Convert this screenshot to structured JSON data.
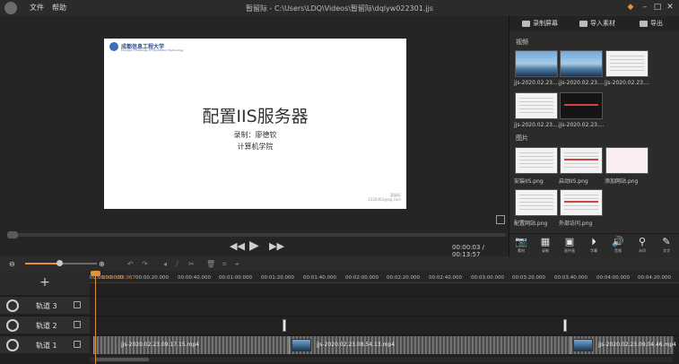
{
  "titlebar": {
    "menu": [
      "文件",
      "帮助"
    ],
    "title": "暂留际 - C:\\Users\\LDQ\\Videos\\暂留际\\dqlyw022301.jjs"
  },
  "preview": {
    "slide": {
      "university": "成都信息工程大学",
      "university_en": "Chengdu University of Information Technology",
      "title": "配置IIS服务器",
      "line1": "录制：廖德钦",
      "line2": "计算机学院",
      "watermark_line1": "暂留际",
      "watermark_line2": "2220062@qq.com"
    },
    "timecode": "00:00:03 / 00:13:57"
  },
  "rightpanel": {
    "tabs": [
      "录制屏幕",
      "导入素材",
      "导出"
    ],
    "videos_label": "视频",
    "videos": [
      {
        "label": "jjs-2020.02.23....",
        "style": "sky"
      },
      {
        "label": "jjs-2020.02.23....",
        "style": "sky"
      },
      {
        "label": "jjs-2020.02.23....",
        "style": "doc"
      },
      {
        "label": "jjs-2020.02.23....",
        "style": "doc"
      },
      {
        "label": "jjs-2020.02.23....",
        "style": "dark"
      }
    ],
    "images_label": "图片",
    "images": [
      {
        "label": "安装IIS.png",
        "style": "doc"
      },
      {
        "label": "启动IIS.png",
        "style": "docred"
      },
      {
        "label": "添加网站.png",
        "style": "pink"
      },
      {
        "label": "配置网站.png",
        "style": "doc"
      },
      {
        "label": "外部访问.png",
        "style": "docred"
      }
    ],
    "tools": [
      "素材",
      "录制",
      "画中画",
      "字幕",
      "音频",
      "水印",
      "文字"
    ]
  },
  "timeline": {
    "ticks": [
      "00:00:00.000",
      "00:00:03.067",
      "00:00:20.000",
      "00:00:40.000",
      "00:01:00.000",
      "00:01:20.000",
      "00:01:40.000",
      "00:02:00.000",
      "00:02:20.000",
      "00:02:40.000",
      "00:03:00.000",
      "00:03:20.000",
      "00:03:40.000",
      "00:04:00.000",
      "00:04:20.000"
    ],
    "tracks": [
      "轨道 3",
      "轨道 2",
      "轨道 1"
    ],
    "clips": [
      "jjs-2020.02.23.09.17.15.mp4",
      "jjs-2020.02.23.08.54.13.mp4",
      "jjs-2020.02.23.09.04.46.mp4"
    ]
  }
}
